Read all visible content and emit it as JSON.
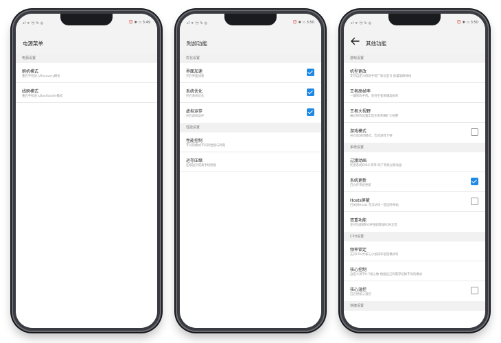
{
  "phone1": {
    "status_left": "ᵢıl ᯤ ⓜ ↻ ◎",
    "status_right": "⏰ ✱ ▭ 3:49",
    "title": "电源菜单",
    "sections": [
      {
        "header": "电源设置",
        "items": [
          {
            "title": "刷机模式",
            "sub": "重启手机进入Recovery模式"
          },
          {
            "title": "线刷模式",
            "sub": "重启手机进入Bootloader模式"
          }
        ]
      }
    ]
  },
  "phone2": {
    "status_left": "ᵢıl ᯤ ⓜ ↻ ◎",
    "status_right": "⏰ ✱ ▭ 3:50",
    "title": "附加功能",
    "sections": [
      {
        "header": "优化设置",
        "items": [
          {
            "title": "界面加速",
            "sub": "开启界面加速",
            "checked": true
          },
          {
            "title": "系统优化",
            "sub": "开启系统优化",
            "checked": true
          },
          {
            "title": "虚拟运存",
            "sub": "开启虚拟运存",
            "checked": true
          }
        ]
      },
      {
        "header": "性能设置",
        "items": [
          {
            "title": "性能控制",
            "sub": "不同的模式不同的性能与耗电"
          },
          {
            "title": "运存压缩",
            "sub": "压缩运存提高手机性能"
          }
        ]
      }
    ]
  },
  "phone3": {
    "status_left": "ᵢıl ᯤ ⓜ ↻ ◎",
    "status_right": "⏰ ✱ ▭ 3:50",
    "title": "其他功能",
    "sections": [
      {
        "header": "游戏设置",
        "items": [
          {
            "title": "机型更改",
            "sub": "支持自定义修改手机厂商与型号 防着笔刷掉帧"
          },
          {
            "title": "王者高帧率",
            "sub": "一键修改手机，支持王者荣耀高帧率"
          },
          {
            "title": "王者大视野",
            "sub": "通过修改设置实现王者荣耀扩大视野"
          },
          {
            "title": "游戏模式",
            "sub": "开启后游戏模式，告别游戏卡顿",
            "checked": false
          }
        ]
      },
      {
        "header": "系统设置",
        "items": [
          {
            "title": "过渡动画",
            "sub": "托盘系统EMUI 简单 除了系统过渡动画"
          },
          {
            "title": "系统更新",
            "sub": "已允许系统更新",
            "checked": true
          },
          {
            "title": "Hosts屏蔽",
            "sub": "已关闭Hosts 无法访问一些国外网站",
            "checked": false
          },
          {
            "title": "双重功能",
            "sub": "支持功能模ROM性能增强ROM正常"
          }
        ]
      },
      {
        "header": "CPU设置",
        "items": [
          {
            "title": "频率锁定",
            "sub": "支持CPU大核与小核频率锁定模式等"
          },
          {
            "title": "核心控制",
            "sub": "自定义调节0-7核心数 根据自己的需求切换不同的模式"
          },
          {
            "title": "核心温控",
            "sub": "已启用核心温控",
            "checked": false
          }
        ]
      },
      {
        "header": "快捷设置",
        "items": []
      }
    ]
  }
}
